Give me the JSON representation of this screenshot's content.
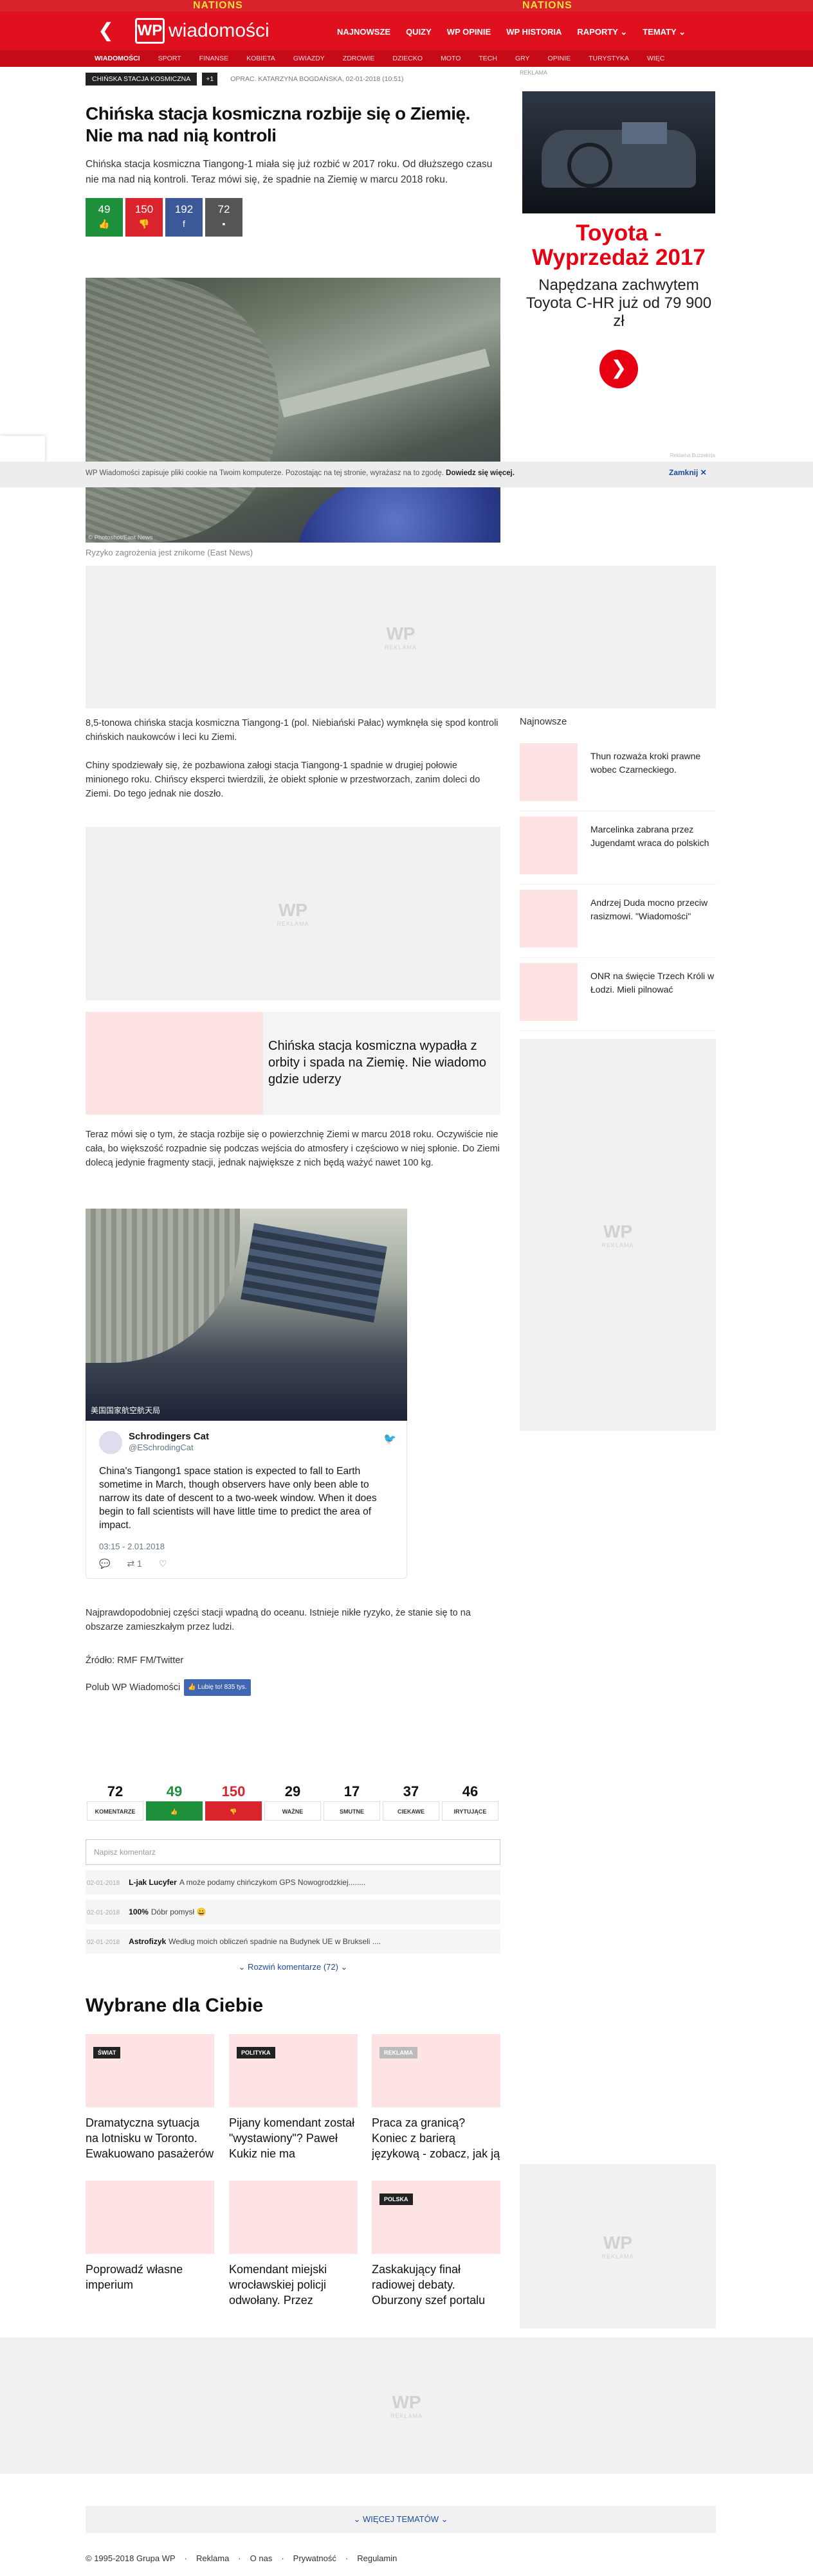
{
  "header": {
    "promo_left": "NATIONS",
    "promo_right": "NATIONS",
    "back_glyph": "❮",
    "logo_mark": "WP",
    "logo_text": "wiadomości",
    "nav": [
      "NAJNOWSZE",
      "QUIZY",
      "WP OPINIE",
      "WP HISTORIA",
      "RAPORTY ⌄",
      "TEMATY ⌄"
    ],
    "subnav": [
      "WIADOMOŚCI",
      "SPORT",
      "FINANSE",
      "KOBIETA",
      "GWIAZDY",
      "ZDROWIE",
      "DZIECKO",
      "MOTO",
      "TECH",
      "GRY",
      "OPINIE",
      "TURYSTYKA",
      "WIĘC"
    ]
  },
  "article": {
    "tag": "CHIŃSKA STACJA KOSMICZNA",
    "tag_plus": "+1",
    "byline": "OPRAC. KATARZYNA BOGDAŃSKA, 02-01-2018 (10:51)",
    "title": "Chińska stacja kosmiczna rozbije się o Ziemię. Nie ma nad nią kontroli",
    "lead": "Chińska stacja kosmiczna Tiangong-1 miała się już rozbić w 2017 roku. Od dłuższego czasu nie ma nad nią kontroli. Teraz mówi się, że spadnie na Ziemię w marcu 2018 roku.",
    "votes": {
      "up": "49",
      "down": "150",
      "fb": "192",
      "comments": "72"
    },
    "image_credit": "© Photoshot/East News",
    "caption": "Ryzyko zagrożenia jest znikome (East News)",
    "p1": "8,5-tonowa chińska stacja kosmiczna Tiangong-1 (pol. Niebiański Pałac) wymknęła się spod kontroli chińskich naukowców i leci ku Ziemi.",
    "p2": "Chiny spodziewały się, że pozbawiona załogi stacja Tiangong-1 spadnie w drugiej połowie minionego roku. Chińscy eksperci twierdzili, że obiekt spłonie w przestworzach, zanim doleci do Ziemi. Do tego jednak nie doszło.",
    "related": "Chińska stacja kosmiczna wypadła z orbity i spada na Ziemię. Nie wiadomo gdzie uderzy",
    "p3": "Teraz mówi się o tym, że stacja rozbije się o powierzchnię Ziemi w marcu 2018 roku. Oczywiście nie cała, bo większość rozpadnie się podczas wejścia do atmosfery i częściowo w niej spłonie. Do Ziemi dolecą jedynie fragmenty stacji, jednak największe z nich będą ważyć nawet 100 kg.",
    "p4": "Najprawdopodobniej części stacji wpadną do oceanu. Istnieje nikłe ryzyko, że stanie się to na obszarze zamieszkałym przez ludzi.",
    "source": "Źródło: RMF FM/Twitter",
    "like_text": "Polub WP Wiadomości",
    "like_btn": "👍 Lubię to! 835 tys."
  },
  "tweet": {
    "image_text": "美国国家航空航天局",
    "name": "Schrodingers Cat",
    "handle": "@ESchrodingCat",
    "text": "China's Tiangong1 space station is expected to fall to Earth sometime in March, though observers have only been able to narrow its date of descent to a two-week window. When it does begin to fall scientists will have little time to predict the area of impact.",
    "date": "03:15 - 2.01.2018",
    "reply_glyph": "💬",
    "retweets": "⇄ 1",
    "like_glyph": "♡"
  },
  "ads": {
    "logo": "WP",
    "label": "REKLAMA"
  },
  "sidebar": {
    "ad_label": "REKLAMA",
    "toyota_brand": "Toyota - Wyprzedaż 2017",
    "toyota_sub": "Napędzana zachwytem Toyota C-HR już od 79 900 zł",
    "toyota_arrow": "❯",
    "toyota_small": "Reklama Buzzekcja",
    "news_title": "Najnowsze",
    "news": [
      "Thun rozważa kroki prawne wobec Czarneckiego.",
      "Marcelinka zabrana przez Jugendamt wraca do polskich",
      "Andrzej Duda mocno przeciw rasizmowi. \"Wiadomości\"",
      "ONR na święcie Trzech Króli w Łodzi. Mieli pilnować"
    ]
  },
  "cookie": {
    "text": "WP Wiadomości zapisuje pliki cookie na Twoim komputerze. Pozostając na tej stronie, wyrażasz na to zgodę.",
    "link": "Dowiedz się więcej.",
    "close": "Zamknij ✕",
    "side_badge": "..."
  },
  "comments": {
    "stats": [
      {
        "num": "72",
        "label": "KOMENTARZE"
      },
      {
        "num": "49",
        "label": "👍"
      },
      {
        "num": "150",
        "label": "👎"
      },
      {
        "num": "29",
        "label": "WAŻNE"
      },
      {
        "num": "17",
        "label": "SMUTNE"
      },
      {
        "num": "37",
        "label": "CIEKAWE"
      },
      {
        "num": "46",
        "label": "IRYTUJĄCE"
      }
    ],
    "input_placeholder": "Napisz komentarz",
    "items": [
      {
        "date": "02-01-2018",
        "user": "L-jak Lucyfer",
        "text": "A może podamy chińczykom GPS Nowogrodzkiej........"
      },
      {
        "date": "02-01-2018",
        "user": "100%",
        "text": "Dóbr pomysł 😀"
      },
      {
        "date": "02-01-2018",
        "user": "Astrofizyk",
        "text": "Według moich obliczeń spadnie na Budynek UE w Brukseli ...."
      }
    ],
    "more": "⌄ Rozwiń komentarze (72) ⌄"
  },
  "picks": {
    "title": "Wybrane dla Ciebie",
    "items": [
      {
        "label": "ŚWIAT",
        "title": "Dramatyczna sytuacja na lotnisku w Toronto. Ewakuowano pasażerów"
      },
      {
        "label": "POLITYKA",
        "title": "Pijany komendant został \"wystawiony\"? Paweł Kukiz nie ma"
      },
      {
        "label": "REKLAMA",
        "title": "Praca za granicą? Koniec z barierą językową - zobacz, jak ją pokonać!"
      },
      {
        "label": "",
        "title": "Poprowadź własne imperium"
      },
      {
        "label": "",
        "title": "Komendant miejski wrocławskiej policji odwołany. Przez"
      },
      {
        "label": "POLSKA",
        "title": "Zaskakujący finał radiowej debaty. Oburzony szef portalu"
      }
    ]
  },
  "more_topics": "⌄ WIĘCEJ TEMATÓW ⌄",
  "footer": [
    "© 1995-2018 Grupa WP",
    "Reklama",
    "O nas",
    "Prywatność",
    "Regulamin"
  ]
}
